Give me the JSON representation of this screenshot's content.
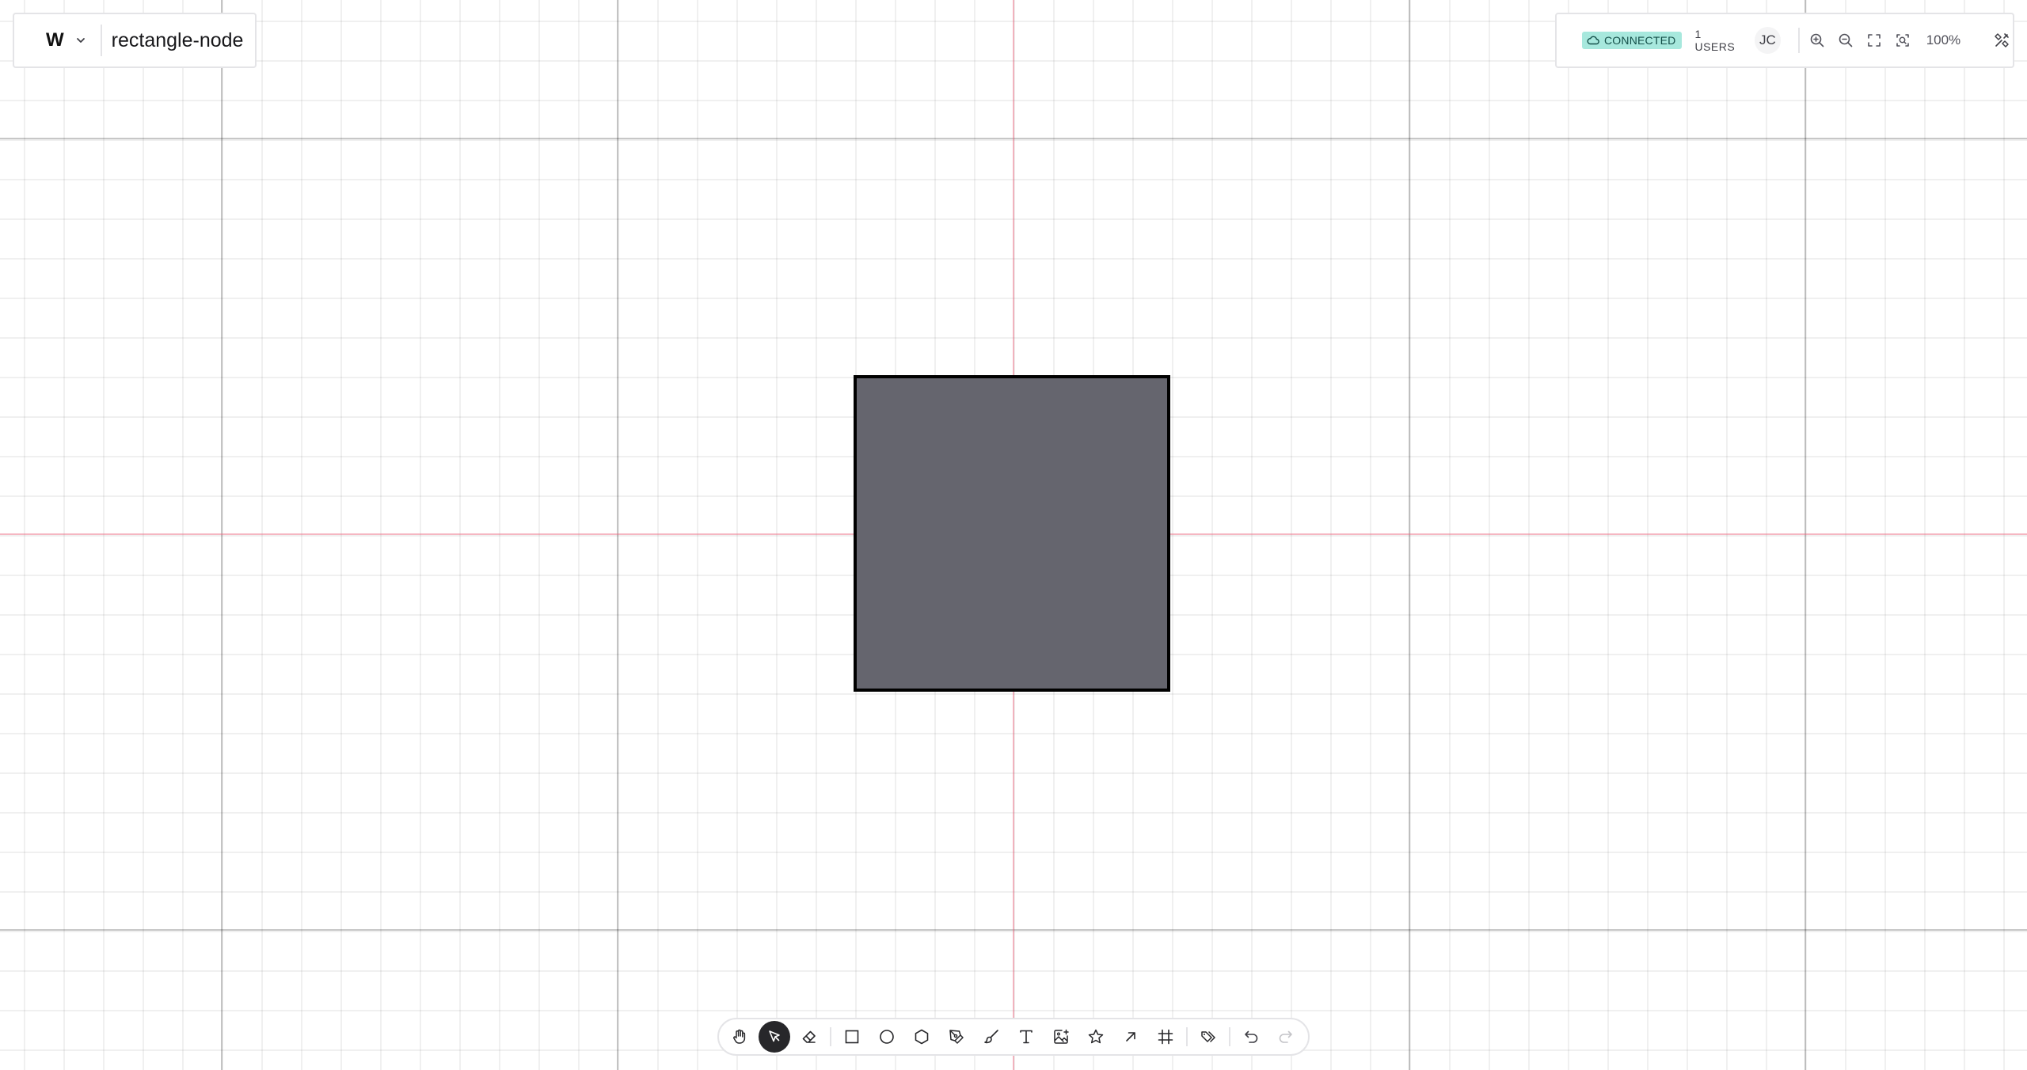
{
  "document": {
    "logo": "W",
    "title": "rectangle-node"
  },
  "status": {
    "connection": "CONNECTED",
    "users": "1 USERS",
    "avatar_initials": "JC",
    "zoom_level": "100%"
  },
  "canvas": {
    "shape": {
      "type": "rectangle",
      "fill": "#65656e",
      "stroke": "#000000"
    },
    "colors": {
      "axis": "#e85f78",
      "badge": "#a7e8dd"
    }
  },
  "icons": {
    "zoom": [
      "zoom-in-icon",
      "zoom-out-icon",
      "fit-screen-icon",
      "zoom-to-selection-icon"
    ],
    "settings": "tools-icon",
    "toolbar": [
      "hand-icon",
      "pointer-icon",
      "eraser-icon",
      "rectangle-icon",
      "ellipse-icon",
      "hexagon-icon",
      "pen-icon",
      "brush-icon",
      "text-icon",
      "image-icon",
      "star-icon",
      "arrow-icon",
      "frame-icon",
      "tags-icon",
      "undo-icon",
      "redo-icon"
    ]
  },
  "toolbar": {
    "active_tool": "pointer"
  }
}
